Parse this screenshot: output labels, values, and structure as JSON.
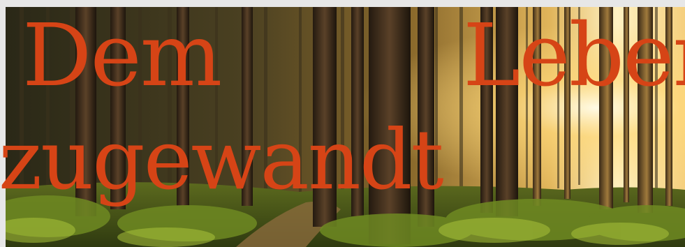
{
  "banner": {
    "headline_words": [
      "Dem",
      "Leben",
      "zugewandt"
    ],
    "text_color": "#d64416",
    "scene": "sunlit-forest-path"
  }
}
